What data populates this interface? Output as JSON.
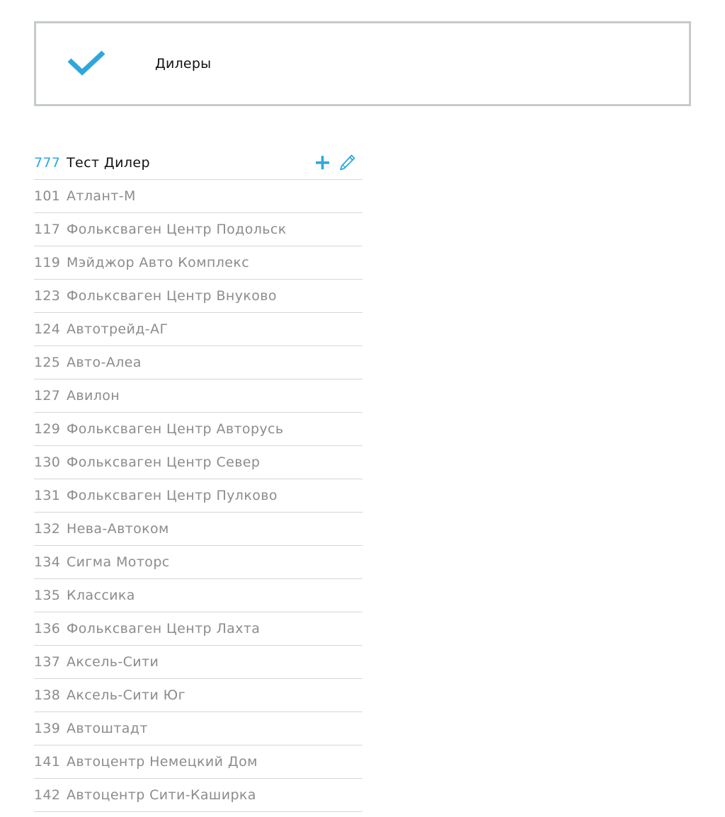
{
  "header": {
    "title": "Дилеры",
    "accent_color": "#2ea7de"
  },
  "dealers": [
    {
      "code": "777",
      "name": "Тест Дилер",
      "active": true
    },
    {
      "code": "101",
      "name": "Атлант-М"
    },
    {
      "code": "117",
      "name": "Фольксваген Центр Подольск"
    },
    {
      "code": "119",
      "name": "Мэйджор Авто Комплекс"
    },
    {
      "code": "123",
      "name": "Фольксваген Центр Внуково"
    },
    {
      "code": "124",
      "name": "Автотрейд-АГ"
    },
    {
      "code": "125",
      "name": "Авто-Алеа"
    },
    {
      "code": "127",
      "name": "Авилон"
    },
    {
      "code": "129",
      "name": "Фольксваген Центр Авторусь"
    },
    {
      "code": "130",
      "name": "Фольксваген Центр Север"
    },
    {
      "code": "131",
      "name": "Фольксваген Центр Пулково"
    },
    {
      "code": "132",
      "name": "Нева-Автоком"
    },
    {
      "code": "134",
      "name": "Сигма Моторс"
    },
    {
      "code": "135",
      "name": "Классика"
    },
    {
      "code": "136",
      "name": "Фольксваген Центр Лахта"
    },
    {
      "code": "137",
      "name": "Аксель-Сити"
    },
    {
      "code": "138",
      "name": "Аксель-Сити Юг"
    },
    {
      "code": "139",
      "name": "Автоштадт"
    },
    {
      "code": "141",
      "name": "Автоцентр Немецкий Дом"
    },
    {
      "code": "142",
      "name": "Автоцентр Сити-Каширка"
    }
  ],
  "icons": {
    "check": "check-icon",
    "add": "plus-icon",
    "edit": "pencil-icon"
  }
}
